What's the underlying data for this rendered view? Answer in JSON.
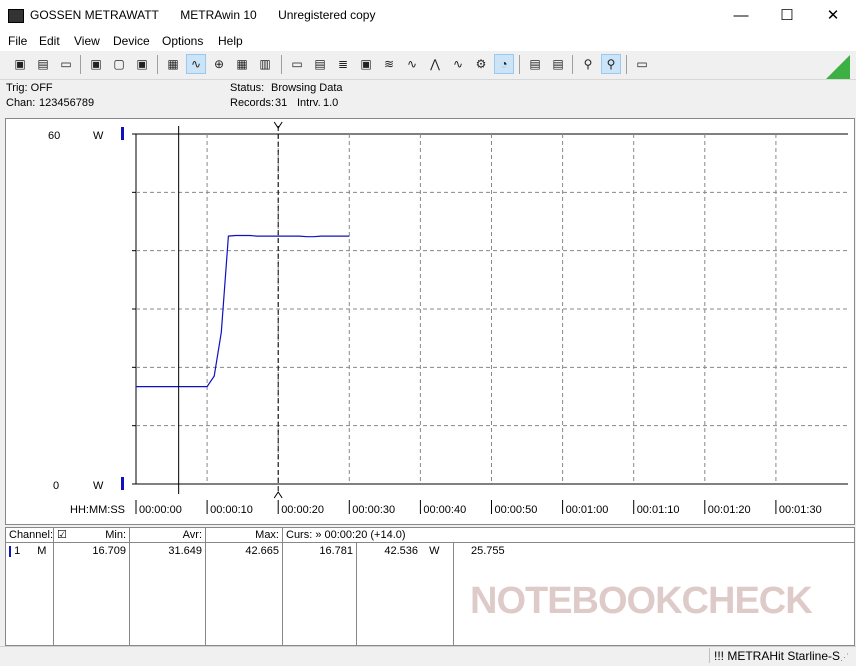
{
  "window": {
    "title_parts": [
      "GOSSEN METRAWATT",
      "METRAwin 10",
      "Unregistered copy"
    ],
    "controls": {
      "minimize": "—",
      "maximize": "☐",
      "close": "✕"
    }
  },
  "menu": [
    "File",
    "Edit",
    "View",
    "Device",
    "Options",
    "Help"
  ],
  "status": {
    "trig": "Trig: OFF",
    "chan_label": "Chan:",
    "chan_value": "123456789",
    "status_label": "Status:",
    "status_value": "Browsing Data",
    "records_label": "Records:",
    "records_value": "31",
    "intrv_label": "Intrv.",
    "intrv_value": "1.0"
  },
  "plot": {
    "y_top": "60",
    "y_bottom": "0",
    "y_unit": "W",
    "x_axis_label": "HH:MM:SS",
    "x_ticks": [
      "00:00:00",
      "00:00:10",
      "00:00:20",
      "00:00:30",
      "00:00:40",
      "00:00:50",
      "00:01:00",
      "00:01:10",
      "00:01:20",
      "00:01:30"
    ]
  },
  "chart_data": {
    "type": "line",
    "x_unit": "s",
    "ylim": [
      0,
      60
    ],
    "xlim": [
      0,
      97
    ],
    "cursor_x": [
      6,
      20
    ],
    "series": [
      {
        "color": "#1010c0",
        "x": [
          0,
          10,
          11,
          12,
          13,
          14,
          15,
          16,
          17,
          18,
          19,
          20,
          21,
          22,
          23,
          24,
          25,
          26,
          27,
          28,
          29,
          30
        ],
        "y": [
          16.7,
          16.7,
          18.5,
          26,
          42.5,
          42.6,
          42.6,
          42.6,
          42.5,
          42.5,
          42.5,
          42.5,
          42.5,
          42.5,
          42.5,
          42.4,
          42.4,
          42.5,
          42.5,
          42.5,
          42.5,
          42.5
        ]
      }
    ]
  },
  "info": {
    "headers": {
      "channel": "Channel:",
      "min": "Min:",
      "avr": "Avr:",
      "max": "Max:",
      "curs": "Curs: » 00:00:20 (+14.0)"
    },
    "row": {
      "chan": "1",
      "mode": "M",
      "min": "16.709",
      "avr": "31.649",
      "max": "42.665",
      "c1": "16.781",
      "c2": "42.536",
      "c2unit": "W",
      "c3": "25.755"
    }
  },
  "footer": {
    "device": "!!! METRAHit Starline-S"
  },
  "watermark": "NOTEBOOKCHECK"
}
